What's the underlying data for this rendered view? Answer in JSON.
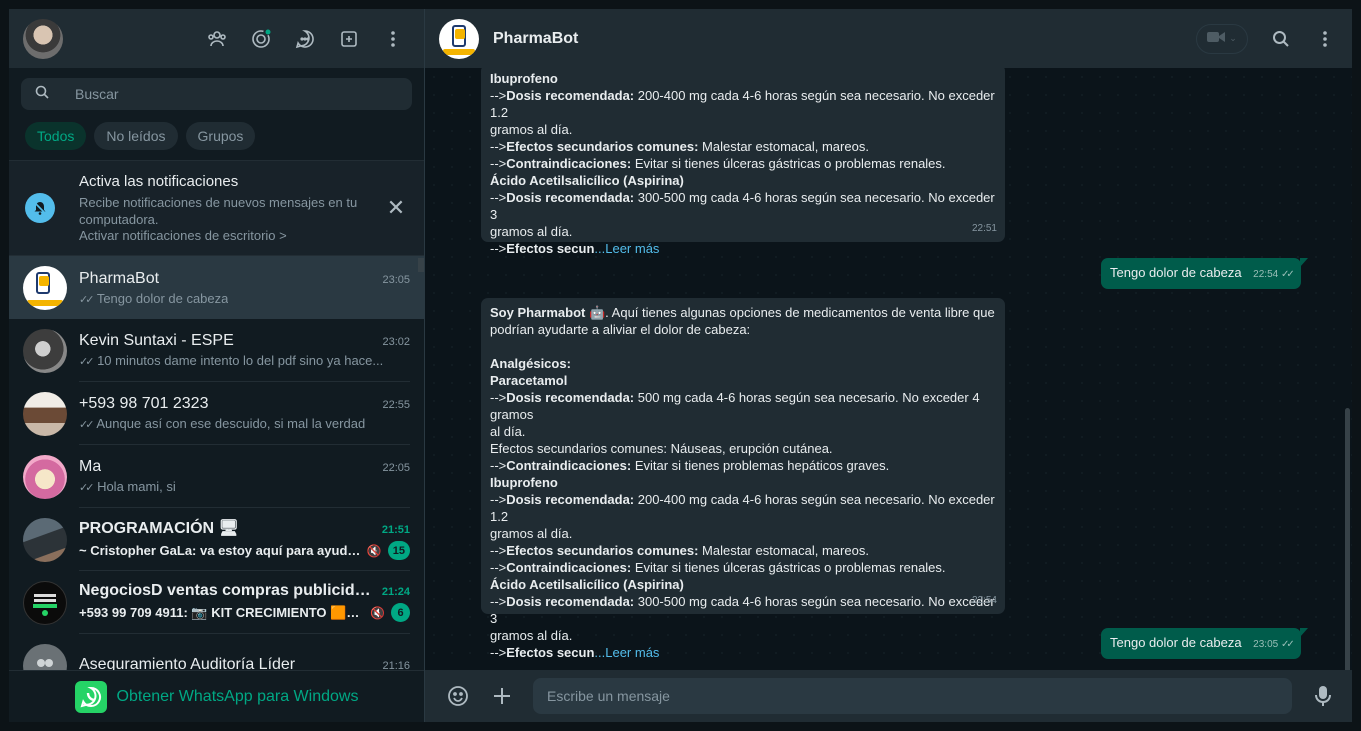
{
  "sidebar": {
    "search_placeholder": "Buscar",
    "filters": [
      "Todos",
      "No leídos",
      "Grupos"
    ],
    "notification": {
      "title": "Activa las notificaciones",
      "description": "Recibe notificaciones de nuevos mensajes en tu computadora.",
      "link": "Activar notificaciones de escritorio >"
    },
    "chats": [
      {
        "name": "PharmaBot",
        "time": "23:05",
        "last": "Tengo dolor de cabeza",
        "ticks": "✓✓"
      },
      {
        "name": "Kevin Suntaxi - ESPE",
        "time": "23:02",
        "last": "10 minutos dame intento lo del pdf sino ya hace...",
        "ticks": "✓✓"
      },
      {
        "name": "+593 98 701 2323",
        "time": "22:55",
        "last": "Aunque así con ese descuido, si mal la verdad",
        "ticks": "✓✓"
      },
      {
        "name": "Ma",
        "time": "22:05",
        "last": "Hola mami, si",
        "ticks": "✓✓"
      },
      {
        "name": "PROGRAMACIÓN 🖥",
        "time": "21:51",
        "last": "~ Cristopher GaLa: va estoy aquí para ayudarte",
        "unread": "15"
      },
      {
        "name": "NegociosD ventas compras publicidad...",
        "time": "21:24",
        "last": "+593 99 709 4911: 📷 KIT CRECIMIENTO 🟧O...",
        "unread": "6"
      },
      {
        "name": "Aseguramiento Auditoría Líder",
        "time": "21:16",
        "last": ""
      }
    ],
    "get_app": "Obtener WhatsApp para Windows"
  },
  "conversation": {
    "title": "PharmaBot",
    "composer_placeholder": "Escribe un mensaje",
    "msg1": {
      "l1": "Ibuprofeno",
      "l2a": "-->",
      "l2b": "Dosis recomendada:",
      "l2c": " 200-400 mg cada 4-6 horas según sea necesario. No exceder 1.2",
      "l3": "gramos al día.",
      "l4a": "-->",
      "l4b": "Efectos secundarios comunes:",
      "l4c": " Malestar estomacal, mareos.",
      "l5a": "-->",
      "l5b": "Contraindicaciones:",
      "l5c": " Evitar si tienes úlceras gástricas o problemas renales.",
      "l6": "Ácido Acetilsalicílico (Aspirina)",
      "l7a": "-->",
      "l7b": "Dosis recomendada:",
      "l7c": " 300-500 mg cada 4-6 horas según sea necesario. No exceder 3",
      "l8": "gramos al día.",
      "l9a": "-->",
      "l9b": "Efectos secun",
      "l9c": "...Leer más",
      "time": "22:51"
    },
    "out1": {
      "text": "Tengo dolor de cabeza",
      "time": "22:54",
      "ticks": "✓✓"
    },
    "msg2": {
      "i1": "Soy Pharmabot",
      "i2": "🤖",
      "i3": ". Aquí tienes algunas opciones de medicamentos de venta libre que",
      "i4": "podrían ayudarte a aliviar el dolor de cabeza:",
      "h1": "Analgésicos:",
      "h2": "Paracetamol",
      "p1a": "-->",
      "p1b": "Dosis recomendada:",
      "p1c": " 500 mg cada 4-6 horas según sea necesario. No exceder 4 gramos",
      "p2": "al día.",
      "p3": "Efectos secundarios comunes: Náuseas, erupción cutánea.",
      "p4a": "-->",
      "p4b": "Contraindicaciones:",
      "p4c": " Evitar si tienes problemas hepáticos graves.",
      "l1": "Ibuprofeno",
      "l2a": "-->",
      "l2b": "Dosis recomendada:",
      "l2c": " 200-400 mg cada 4-6 horas según sea necesario. No exceder 1.2",
      "l3": "gramos al día.",
      "l4a": "-->",
      "l4b": "Efectos secundarios comunes:",
      "l4c": " Malestar estomacal, mareos.",
      "l5a": "-->",
      "l5b": "Contraindicaciones:",
      "l5c": " Evitar si tienes úlceras gástricas o problemas renales.",
      "l6": "Ácido Acetilsalicílico (Aspirina)",
      "l7a": "-->",
      "l7b": "Dosis recomendada:",
      "l7c": " 300-500 mg cada 4-6 horas según sea necesario. No exceder 3",
      "l8": "gramos al día.",
      "l9a": "-->",
      "l9b": "Efectos secun",
      "l9c": "...Leer más",
      "time": "22:54"
    },
    "out2": {
      "text": "Tengo dolor de cabeza",
      "time": "23:05",
      "ticks": "✓✓"
    }
  },
  "colors": {
    "accent": "#00a884",
    "outgoing_bubble": "#005c4b",
    "incoming_bubble": "#202c33",
    "panel": "#202c33",
    "link": "#53bdeb"
  }
}
